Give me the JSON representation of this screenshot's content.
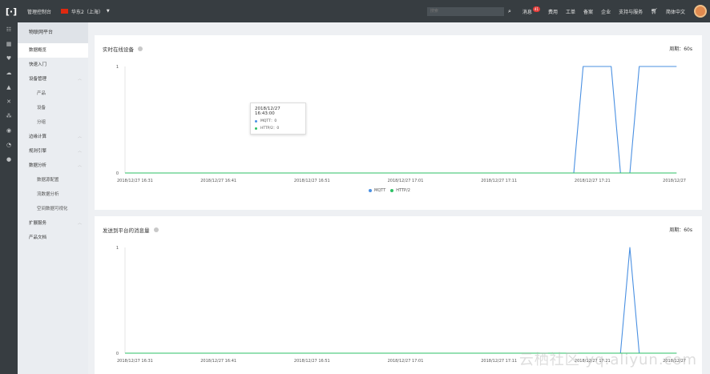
{
  "topbar": {
    "console_label": "管理控制台",
    "region_label": "华东2（上海）",
    "search_placeholder": "搜索",
    "nav": [
      "消息",
      "费用",
      "工单",
      "备案",
      "企业",
      "支持与服务"
    ],
    "message_badge": "41",
    "language": "简体中文"
  },
  "sidebar": {
    "title": "物联网平台",
    "items": [
      {
        "label": "数据概览",
        "active": true,
        "sub": false,
        "chevron": false
      },
      {
        "label": "快速入门",
        "active": false,
        "sub": false,
        "chevron": false
      },
      {
        "label": "设备管理",
        "active": false,
        "sub": false,
        "chevron": true
      },
      {
        "label": "产品",
        "active": false,
        "sub": true,
        "chevron": false
      },
      {
        "label": "设备",
        "active": false,
        "sub": true,
        "chevron": false
      },
      {
        "label": "分组",
        "active": false,
        "sub": true,
        "chevron": false
      },
      {
        "label": "边缘计算",
        "active": false,
        "sub": false,
        "chevron": true
      },
      {
        "label": "规则引擎",
        "active": false,
        "sub": false,
        "chevron": true
      },
      {
        "label": "数据分析",
        "active": false,
        "sub": false,
        "chevron": true
      },
      {
        "label": "数据源配置",
        "active": false,
        "sub": true,
        "chevron": false
      },
      {
        "label": "流数据分析",
        "active": false,
        "sub": true,
        "chevron": false
      },
      {
        "label": "空间数据可视化",
        "active": false,
        "sub": true,
        "chevron": false
      },
      {
        "label": "扩展服务",
        "active": false,
        "sub": false,
        "chevron": true
      },
      {
        "label": "产品文档",
        "active": false,
        "sub": false,
        "chevron": false
      }
    ]
  },
  "panels": {
    "online": {
      "title": "实时在线设备",
      "period": "周期：60s",
      "tooltip": {
        "time": "2018/12/27 16:43:00",
        "rows": [
          "MQTT：0",
          "HTTP/2：0"
        ]
      },
      "legend": [
        "MQTT",
        "HTTP/2"
      ]
    },
    "messages": {
      "title": "发送到平台的消息量",
      "period": "周期：60s"
    }
  },
  "watermark": "云栖社区 yq.aliyun.com",
  "colors": {
    "mqtt": "#4a90e2",
    "http2": "#2ec265",
    "topbar": "#373d41"
  },
  "chart_data": [
    {
      "type": "line",
      "title": "实时在线设备",
      "x_ticks": [
        "2018/12/27 16:31",
        "2018/12/27 16:41",
        "2018/12/27 16:51",
        "2018/12/27 17:01",
        "2018/12/27 17:11",
        "2018/12/27 17:21",
        "2018/12/27"
      ],
      "y_ticks": [
        "0",
        "1"
      ],
      "ylim": [
        0,
        1
      ],
      "series": [
        {
          "name": "MQTT",
          "x": [
            "2018/12/27 16:31",
            "2018/12/27 17:19",
            "2018/12/27 17:20",
            "2018/12/27 17:23",
            "2018/12/27 17:24",
            "2018/12/27 17:25",
            "2018/12/27 17:26",
            "2018/12/27 17:27",
            "2018/12/27 17:30"
          ],
          "values": [
            0,
            0,
            1,
            1,
            0,
            0,
            1,
            1,
            1
          ]
        },
        {
          "name": "HTTP/2",
          "x": [
            "2018/12/27 16:31",
            "2018/12/27 17:30"
          ],
          "values": [
            0,
            0
          ]
        }
      ],
      "legend": "bottom-center"
    },
    {
      "type": "line",
      "title": "发送到平台的消息量",
      "x_ticks": [
        "2018/12/27 16:31",
        "2018/12/27 16:41",
        "2018/12/27 16:51",
        "2018/12/27 17:01",
        "2018/12/27 17:11",
        "2018/12/27 17:21",
        "2018/12/27"
      ],
      "y_ticks": [
        "0",
        "1"
      ],
      "ylim": [
        0,
        1
      ],
      "series": [
        {
          "name": "MQTT",
          "x": [
            "2018/12/27 16:31",
            "2018/12/27 17:24",
            "2018/12/27 17:25",
            "2018/12/27 17:26",
            "2018/12/27 17:30"
          ],
          "values": [
            0,
            0,
            1,
            0,
            0
          ]
        },
        {
          "name": "HTTP/2",
          "x": [
            "2018/12/27 16:31",
            "2018/12/27 17:30"
          ],
          "values": [
            0,
            0
          ]
        }
      ]
    }
  ]
}
